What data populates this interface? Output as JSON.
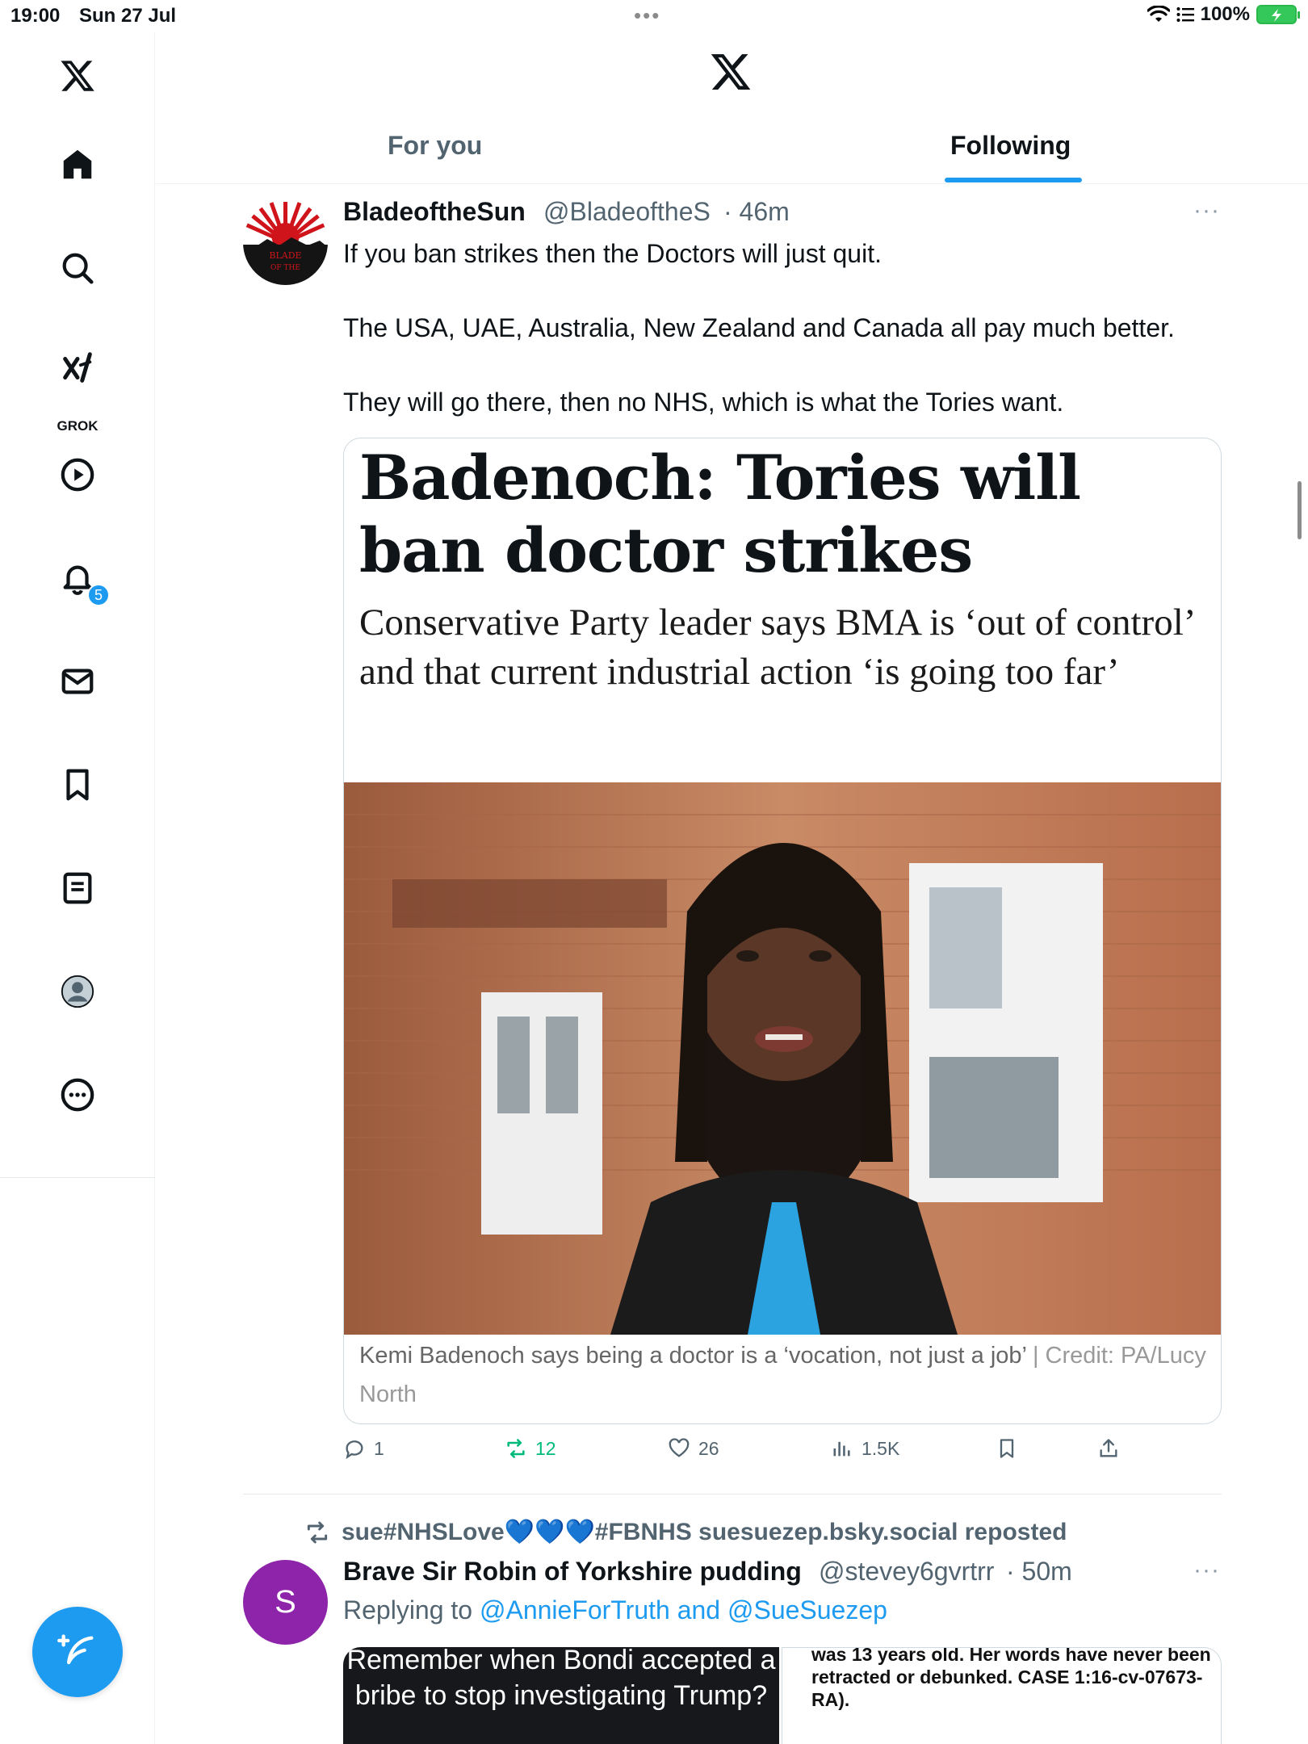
{
  "status_bar": {
    "time": "19:00",
    "date": "Sun 27 Jul",
    "battery": "100%",
    "icons": [
      "wifi-icon",
      "list-icon",
      "battery-charging-icon"
    ]
  },
  "sidebar": {
    "items": [
      {
        "name": "x-logo-icon"
      },
      {
        "name": "home-icon"
      },
      {
        "name": "search-icon"
      },
      {
        "name": "grok-icon",
        "label": "GROK"
      },
      {
        "name": "video-play-icon"
      },
      {
        "name": "notifications-bell-icon",
        "badge": "5"
      },
      {
        "name": "messages-mail-icon"
      },
      {
        "name": "bookmarks-icon"
      },
      {
        "name": "lists-icon"
      },
      {
        "name": "profile-avatar-icon"
      },
      {
        "name": "more-options-icon"
      }
    ],
    "compose_button": "compose-post-icon"
  },
  "header": {
    "tabs": [
      {
        "label": "For you",
        "active": false
      },
      {
        "label": "Following",
        "active": true
      }
    ],
    "accent_color": "#1d9bf0"
  },
  "tweets": [
    {
      "display_name": "BladeoftheSun",
      "handle": "@BladeoftheS",
      "time": "· 46m",
      "more": "···",
      "avatar_text_1": "BLADE",
      "avatar_text_2": "OF THE",
      "text_lines": [
        "If you ban strikes then the Doctors will just quit.",
        "The USA, UAE, Australia, New Zealand and Canada all pay much better.",
        "They will go there, then no NHS, which is what the Tories want."
      ],
      "card": {
        "headline": "Badenoch: Tories will ban doctor strikes",
        "standfirst": "Conservative Party leader says BMA is ‘out of control’ and that current industrial action ‘is going too far’",
        "caption": "Kemi Badenoch says being a doctor is a ‘vocation, not just a job’",
        "credit": " | Credit: PA/Lucy North"
      },
      "actions": {
        "replies": "1",
        "reposts": "12",
        "likes": "26",
        "views": "1.5K"
      }
    },
    {
      "repost_by": "sue#NHSLove💙💙💙#FBNHS suesuezep.bsky.social reposted",
      "display_name": "Brave Sir Robin of Yorkshire pudding",
      "handle": "@stevey6gvrtrr",
      "time": "· 50m",
      "more": "···",
      "avatar_letter": "S",
      "avatar_color": "#8e24aa",
      "reply_prefix": "Replying to ",
      "reply_targets": "@AnnieForTruth and @SueSuezep",
      "media_left_text": "Remember when Bondi accepted a bribe to stop investigating Trump?",
      "media_right_text": "was 13 years old. Her words have never been retracted or debunked. CASE 1:16-cv-07673-RA)."
    }
  ]
}
